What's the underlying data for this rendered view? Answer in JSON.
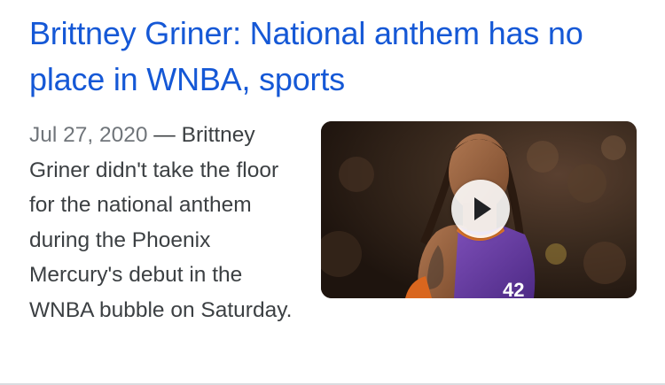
{
  "result": {
    "title": "Brittney Griner: National anthem has no place in WNBA, sports",
    "date": "Jul 27, 2020",
    "separator": " — ",
    "snippet": "Brittney Griner didn't take the floor for the national anthem during the Phoenix Mercury's debut in the WNBA bubble on Saturday.",
    "thumbnail": {
      "icon": "play-icon",
      "jersey_number": "42"
    }
  },
  "colors": {
    "title": "#1558d6",
    "snippet": "#3c4043",
    "date": "#70757a",
    "divider": "#dadce0"
  }
}
